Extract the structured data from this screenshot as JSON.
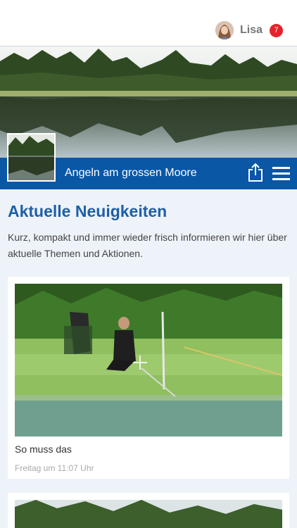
{
  "header": {
    "user_name": "Lisa",
    "notification_count": "7"
  },
  "group": {
    "title": "Angeln am grossen Moore"
  },
  "news": {
    "title": "Aktuelle Neuigkeiten",
    "description": "Kurz, kompakt und immer wieder frisch informieren wir hier über aktuelle Themen und Aktionen.",
    "posts": [
      {
        "caption": "So muss das",
        "time": "Freitag um 11:07 Uhr"
      }
    ]
  },
  "colors": {
    "brand_blue": "#0a57a6",
    "title_blue": "#1e5fa8",
    "badge_red": "#e3222b",
    "page_bg": "#eef3fa"
  },
  "icons": [
    "share-icon",
    "hamburger-menu-icon"
  ]
}
